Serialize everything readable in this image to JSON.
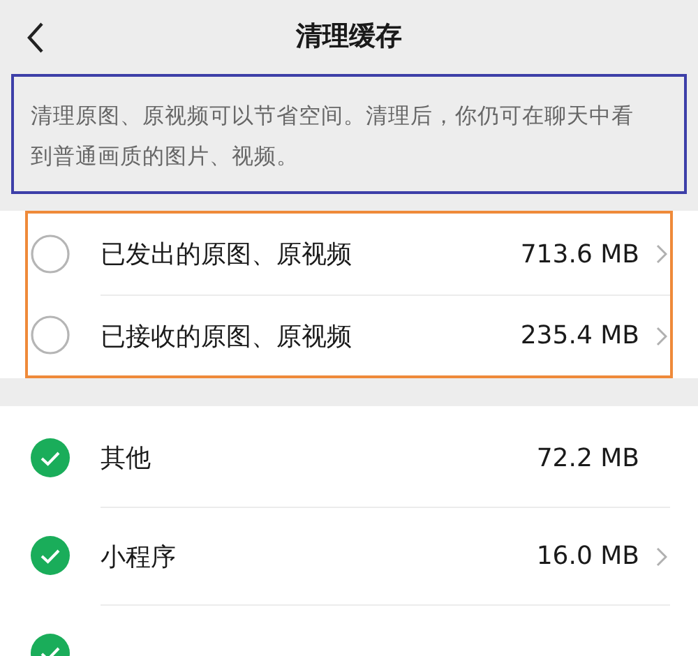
{
  "header": {
    "title": "清理缓存"
  },
  "notice": {
    "text": "清理原图、原视频可以节省空间。清理后，你仍可在聊天中看到普通画质的图片、视频。"
  },
  "groups": [
    {
      "highlighted": true,
      "items": [
        {
          "label": "已发出的原图、原视频",
          "size": "713.6 MB",
          "checked": false,
          "chevron": true
        },
        {
          "label": "已接收的原图、原视频",
          "size": "235.4 MB",
          "checked": false,
          "chevron": true
        }
      ]
    },
    {
      "highlighted": false,
      "items": [
        {
          "label": "其他",
          "size": "72.2 MB",
          "checked": true,
          "chevron": false
        },
        {
          "label": "小程序",
          "size": "16.0 MB",
          "checked": true,
          "chevron": true
        },
        {
          "checked": true
        }
      ]
    }
  ]
}
